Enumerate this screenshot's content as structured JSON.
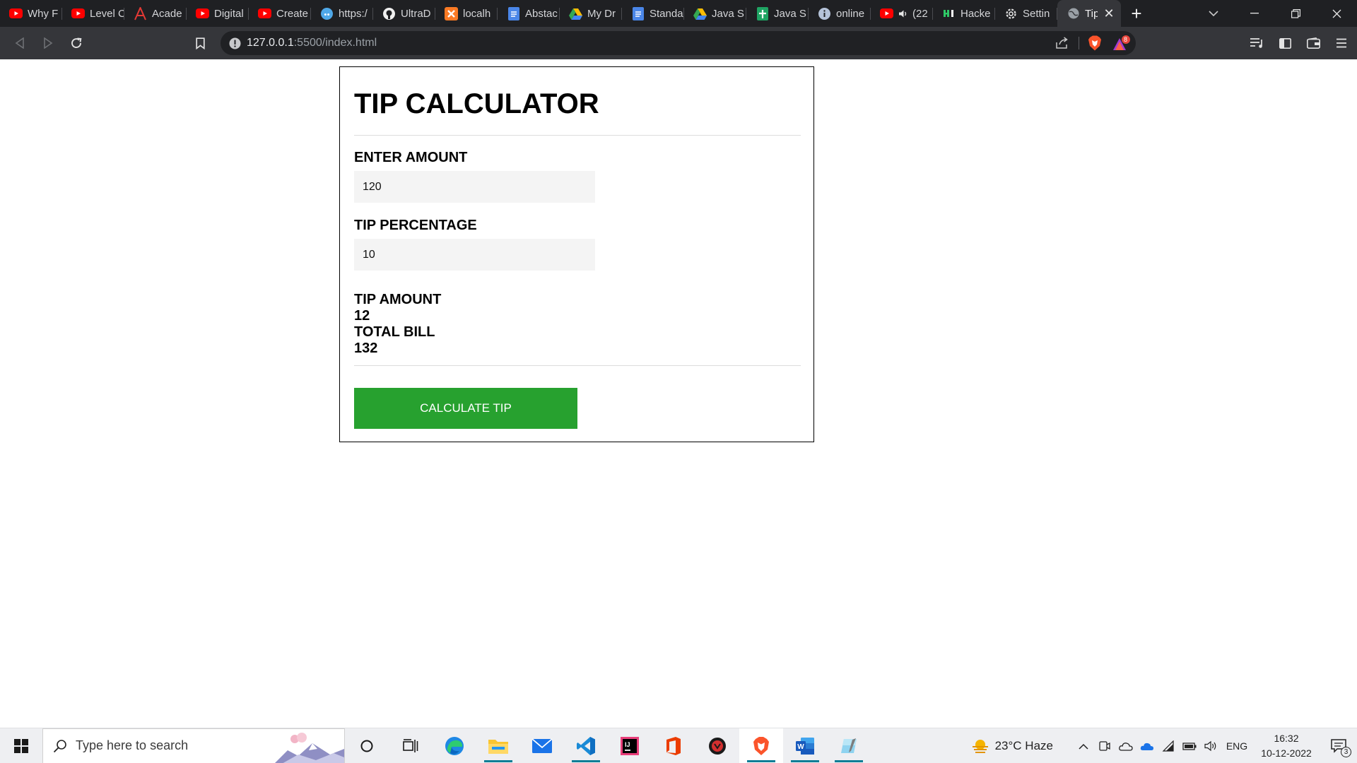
{
  "browser": {
    "tabs": [
      {
        "title": "Why F",
        "icon": "youtube-icon"
      },
      {
        "title": "Level C",
        "icon": "youtube-icon"
      },
      {
        "title": "Acade",
        "icon": "academia-icon"
      },
      {
        "title": "Digital",
        "icon": "youtube-icon"
      },
      {
        "title": "Create",
        "icon": "youtube-icon"
      },
      {
        "title": "https:/",
        "icon": "globe-blue-icon"
      },
      {
        "title": "UltraD",
        "icon": "github-icon"
      },
      {
        "title": "localh",
        "icon": "xampp-icon"
      },
      {
        "title": "Abstac",
        "icon": "google-docs-icon"
      },
      {
        "title": "My Dr",
        "icon": "google-drive-icon"
      },
      {
        "title": "Standa",
        "icon": "google-docs-icon"
      },
      {
        "title": "Java S",
        "icon": "google-drive-icon"
      },
      {
        "title": "Java S",
        "icon": "google-sheets-icon"
      },
      {
        "title": "online",
        "icon": "info-icon"
      },
      {
        "title": "(22",
        "icon": "youtube-icon"
      },
      {
        "title": "Hacke",
        "icon": "hackerrank-icon"
      },
      {
        "title": "Settin",
        "icon": "gear-icon"
      },
      {
        "title": "Tip",
        "icon": "globe-icon"
      }
    ],
    "url_host": "127.0.0.1",
    "url_path": ":5500/index.html",
    "shield_badge": "8"
  },
  "app": {
    "title": "TIP CALCULATOR",
    "amount_label": "ENTER AMOUNT",
    "amount_value": "120",
    "percent_label": "TIP PERCENTAGE",
    "percent_value": "10",
    "tip_amount_label": "TIP AMOUNT",
    "tip_amount_value": "12",
    "total_bill_label": "TOTAL BILL",
    "total_bill_value": "132",
    "button_label": "CALCULATE TIP",
    "accent_color": "#27a12f"
  },
  "taskbar": {
    "search_placeholder": "Type here to search",
    "weather": "23°C  Haze",
    "language": "ENG",
    "time": "16:32",
    "date": "10-12-2022",
    "notification_count": "3"
  }
}
